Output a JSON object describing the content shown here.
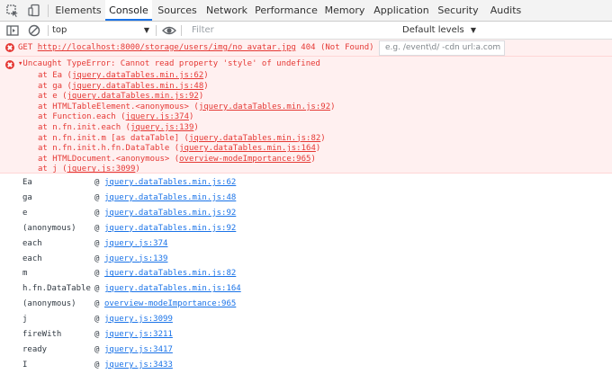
{
  "tabs": [
    "Elements",
    "Console",
    "Sources",
    "Network",
    "Performance",
    "Memory",
    "Application",
    "Security",
    "Audits"
  ],
  "active_tab": "Console",
  "toolbar": {
    "context": "top",
    "filter_placeholder": "Filter",
    "levels": "Default levels"
  },
  "tooltip": "e.g. /event\\d/ -cdn url:a.com",
  "error1": {
    "method": "GET",
    "url": "http://localhost:8000/storage/users/img/no_avatar.jpg",
    "status": "404 (Not Found)"
  },
  "error2": {
    "message": "Uncaught TypeError: Cannot read property 'style' of undefined",
    "frames": [
      {
        "pre": "at Ea (",
        "link": "jquery.dataTables.min.js:62",
        "post": ")"
      },
      {
        "pre": "at ga (",
        "link": "jquery.dataTables.min.js:48",
        "post": ")"
      },
      {
        "pre": "at e (",
        "link": "jquery.dataTables.min.js:92",
        "post": ")"
      },
      {
        "pre": "at HTMLTableElement.<anonymous> (",
        "link": "jquery.dataTables.min.js:92",
        "post": ")"
      },
      {
        "pre": "at Function.each (",
        "link": "jquery.js:374",
        "post": ")"
      },
      {
        "pre": "at n.fn.init.each (",
        "link": "jquery.js:139",
        "post": ")"
      },
      {
        "pre": "at n.fn.init.m [as dataTable] (",
        "link": "jquery.dataTables.min.js:82",
        "post": ")"
      },
      {
        "pre": "at n.fn.init.h.fn.DataTable (",
        "link": "jquery.dataTables.min.js:164",
        "post": ")"
      },
      {
        "pre": "at HTMLDocument.<anonymous> (",
        "link": "overview-modeImportance:965",
        "post": ")"
      },
      {
        "pre": "at j (",
        "link": "jquery.js:3099",
        "post": ")"
      }
    ]
  },
  "stack": [
    {
      "fn": "Ea",
      "link": "jquery.dataTables.min.js:62"
    },
    {
      "fn": "ga",
      "link": "jquery.dataTables.min.js:48"
    },
    {
      "fn": "e",
      "link": "jquery.dataTables.min.js:92"
    },
    {
      "fn": "(anonymous)",
      "link": "jquery.dataTables.min.js:92"
    },
    {
      "fn": "each",
      "link": "jquery.js:374"
    },
    {
      "fn": "each",
      "link": "jquery.js:139"
    },
    {
      "fn": "m",
      "link": "jquery.dataTables.min.js:82"
    },
    {
      "fn": "h.fn.DataTable",
      "link": "jquery.dataTables.min.js:164"
    },
    {
      "fn": "(anonymous)",
      "link": "overview-modeImportance:965"
    },
    {
      "fn": "j",
      "link": "jquery.js:3099"
    },
    {
      "fn": "fireWith",
      "link": "jquery.js:3211"
    },
    {
      "fn": "ready",
      "link": "jquery.js:3417"
    },
    {
      "fn": "I",
      "link": "jquery.js:3433"
    }
  ],
  "at_sign": "@",
  "colors": {
    "accent": "#1a73e8",
    "error": "#e53935",
    "error_bg": "#fff0f0"
  }
}
